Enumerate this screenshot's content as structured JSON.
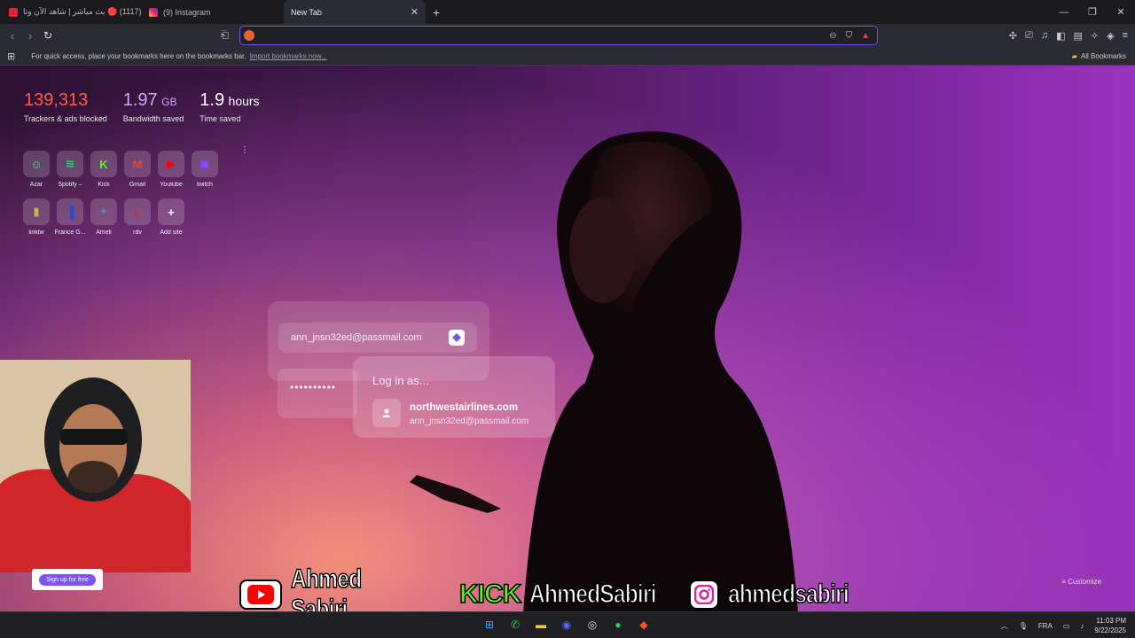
{
  "tabs": [
    {
      "label": "(1117) 🔴 بث مباشر | شاهد الآن وتا",
      "favicon": "youtube-icon",
      "color": "#e8213a"
    },
    {
      "label": "(9) Instagram",
      "favicon": "instagram-icon",
      "color": "#d6249f"
    },
    {
      "label": "New Tab",
      "close": "✕"
    }
  ],
  "new_tab": "+",
  "address_bar": {
    "value": "",
    "placeholder": ""
  },
  "bookmarks_bar": {
    "hint": "For quick access, place your bookmarks here on the bookmarks bar.",
    "import_link": "Import bookmarks now...",
    "all_bookmarks": "All Bookmarks"
  },
  "stats": [
    {
      "num": "139,313",
      "unit": "",
      "label": "Trackers & ads blocked",
      "color": "#ff5a4a"
    },
    {
      "num": "1.97",
      "unit": "GB",
      "label": "Bandwidth saved",
      "color": "#c9a7ff"
    },
    {
      "num": "1.9",
      "unit": "hours",
      "label": "Time saved",
      "color": "#ffffff"
    }
  ],
  "top_sites": [
    {
      "name": "Azar",
      "icon": "azar-icon",
      "glyph": "☺",
      "color": "#2ee88a"
    },
    {
      "name": "Spotify –",
      "icon": "spotify-icon",
      "glyph": "≋",
      "color": "#1ed760"
    },
    {
      "name": "Kick",
      "icon": "kick-icon",
      "glyph": "K",
      "color": "#53fc18"
    },
    {
      "name": "Gmail",
      "icon": "gmail-icon",
      "glyph": "M",
      "color": "#ea4335"
    },
    {
      "name": "Youtube",
      "icon": "youtube-icon",
      "glyph": "▶",
      "color": "#ff0000"
    },
    {
      "name": "twitch",
      "icon": "twitch-icon",
      "glyph": "▣",
      "color": "#9146ff"
    },
    {
      "name": "linktw",
      "icon": "linktw-icon",
      "glyph": "▮",
      "color": "#c9b15a"
    },
    {
      "name": "France G...",
      "icon": "france-icon",
      "glyph": "▐",
      "color": "#1d4ed8"
    },
    {
      "name": "Ameli",
      "icon": "ameli-icon",
      "glyph": "✦",
      "color": "#6b7bb8"
    },
    {
      "name": "rdv",
      "icon": "rdv-icon",
      "glyph": "◐",
      "color": "#e11d2e"
    },
    {
      "name": "Add site",
      "icon": "plus-icon",
      "glyph": "+",
      "color": "#ffffff"
    }
  ],
  "promo": {
    "email": "ann_jnsn32ed@passmail.com",
    "password": "••••••••••",
    "login_title": "Log in as...",
    "site": "northwestairlines.com",
    "user": "ann_jnsn32ed@passmail.com"
  },
  "customize": "Customize",
  "signup": "Sign up for free",
  "banner": {
    "youtube": "Ahmed Sabiri",
    "kick_logo": "KICK",
    "kick": "AhmedSabiri",
    "instagram": "ahmedsabiri"
  },
  "taskbar": {
    "lang": "FRA",
    "time": "11:03 PM",
    "date": "9/22/2025"
  }
}
